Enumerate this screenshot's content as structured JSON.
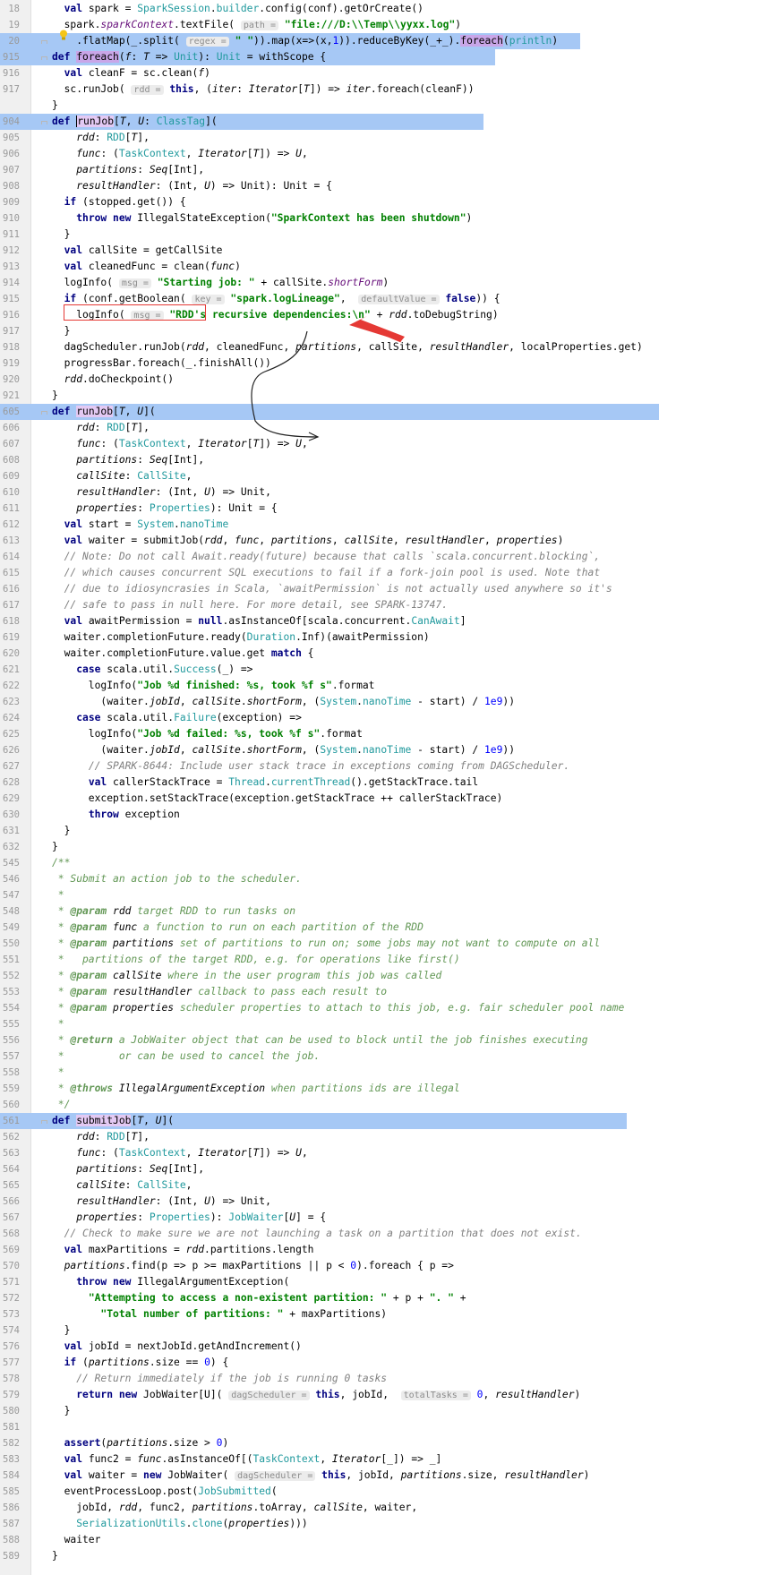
{
  "editor": {
    "highlight_color": "#a6c8f5",
    "annotation_color": "#e53935",
    "lines": [
      {
        "n": "18",
        "h": "  <span class=\"kw\">val</span> spark = <span class=\"typ\">SparkSession</span>.<span class=\"typ\">builder</span>.config(conf).getOrCreate()"
      },
      {
        "n": "19",
        "h": "  spark.<span class=\"fld\">sparkContext</span>.textFile( <span class=\"hint\">path =</span> <span class=\"str\">\"file:///D:\\\\Temp\\\\yyxx.log\"</span>)"
      },
      {
        "n": "20",
        "hl": true,
        "h": "    .flatMap(_.split( <span class=\"hint\">regex =</span> <span class=\"str\">\" \"</span>)).map(x=>(x,<span class=\"num\">1</span>)).reduceByKey(_+_).<span class=\"mark\">foreach</span>(<span class=\"typ\">println</span>)"
      },
      {
        "n": "915",
        "hl": true,
        "h": "<span class=\"kw\">def</span> <span class=\"mark\">foreach</span>(<span class=\"ital\">f</span>: <span class=\"ital\">T</span> => <span class=\"typ\">Unit</span>): <span class=\"typ\">Unit</span> = withScope {"
      },
      {
        "n": "916",
        "h": "  <span class=\"kw\">val</span> cleanF = sc.clean(<span class=\"ital\">f</span>)"
      },
      {
        "n": "917",
        "h": "  sc.runJob( <span class=\"hint\">rdd =</span> <span class=\"kw\">this</span>, (<span class=\"ital\">iter</span>: <span class=\"ital\">Iterator</span>[<span class=\"ital\">T</span>]) => <span class=\"ital\">iter</span>.foreach(cleanF))"
      },
      {
        "n": "",
        "h": "}"
      },
      {
        "n": "904",
        "hl": true,
        "h": "<span class=\"kw\">def</span> <span class=\"mark2 caret\">runJob</span>[<span class=\"ital\">T</span>, <span class=\"ital\">U</span>: <span class=\"typ\">ClassTag</span>]("
      },
      {
        "n": "905",
        "h": "    <span class=\"ital\">rdd</span>: <span class=\"typ\">RDD</span>[<span class=\"ital\">T</span>],"
      },
      {
        "n": "906",
        "h": "    <span class=\"ital\">func</span>: (<span class=\"typ\">TaskContext</span>, <span class=\"ital\">Iterator</span>[<span class=\"ital\">T</span>]) => <span class=\"ital\">U</span>,"
      },
      {
        "n": "907",
        "h": "    <span class=\"ital\">partitions</span>: <span class=\"ital\">Seq</span>[Int],"
      },
      {
        "n": "908",
        "h": "    <span class=\"ital\">resultHandler</span>: (Int, <span class=\"ital\">U</span>) => Unit): Unit = {"
      },
      {
        "n": "909",
        "h": "  <span class=\"kw\">if</span> (stopped.get()) {"
      },
      {
        "n": "910",
        "h": "    <span class=\"kw\">throw new</span> IllegalStateException(<span class=\"str\">\"SparkContext has been shutdown\"</span>)"
      },
      {
        "n": "911",
        "h": "  }"
      },
      {
        "n": "912",
        "h": "  <span class=\"kw\">val</span> callSite = getCallSite"
      },
      {
        "n": "913",
        "h": "  <span class=\"kw\">val</span> cleanedFunc = clean(<span class=\"ital\">func</span>)"
      },
      {
        "n": "914",
        "h": "  logInfo( <span class=\"hint\">msg =</span> <span class=\"str\">\"Starting job: \"</span> + callSite.<span class=\"fld\">shortForm</span>)"
      },
      {
        "n": "915",
        "h": "  <span class=\"kw\">if</span> (conf.getBoolean( <span class=\"hint\">key =</span> <span class=\"str\">\"spark.logLineage\"</span>,  <span class=\"hint\">defaultValue =</span> <span class=\"kw\">false</span>)) {"
      },
      {
        "n": "916",
        "h": "    logInfo( <span class=\"hint\">msg =</span> <span class=\"str\">\"RDD's recursive dependencies:\\n\"</span> + <span class=\"ital\">rdd</span>.toDebugString)"
      },
      {
        "n": "917",
        "h": "  }"
      },
      {
        "n": "918",
        "h": "  dagScheduler.runJob(<span class=\"ital\">rdd</span>, cleanedFunc, <span class=\"ital\">partitions</span>, callSite, <span class=\"ital\">resultHandler</span>, localProperties.get)"
      },
      {
        "n": "919",
        "h": "  progressBar.foreach(_.finishAll())"
      },
      {
        "n": "920",
        "h": "  <span class=\"ital\">rdd</span>.doCheckpoint()"
      },
      {
        "n": "921",
        "h": "}"
      },
      {
        "n": "605",
        "hl": true,
        "h": "<span class=\"kw\">def</span> <span class=\"mark2\">runJob</span>[<span class=\"ital\">T</span>, <span class=\"ital\">U</span>]("
      },
      {
        "n": "606",
        "h": "    <span class=\"ital\">rdd</span>: <span class=\"typ\">RDD</span>[<span class=\"ital\">T</span>],"
      },
      {
        "n": "607",
        "h": "    <span class=\"ital\">func</span>: (<span class=\"typ\">TaskContext</span>, <span class=\"ital\">Iterator</span>[<span class=\"ital\">T</span>]) => <span class=\"ital\">U</span>,"
      },
      {
        "n": "608",
        "h": "    <span class=\"ital\">partitions</span>: <span class=\"ital\">Seq</span>[Int],"
      },
      {
        "n": "609",
        "h": "    <span class=\"ital\">callSite</span>: <span class=\"typ\">CallSite</span>,"
      },
      {
        "n": "610",
        "h": "    <span class=\"ital\">resultHandler</span>: (Int, <span class=\"ital\">U</span>) => Unit,"
      },
      {
        "n": "611",
        "h": "    <span class=\"ital\">properties</span>: <span class=\"typ\">Properties</span>): Unit = {"
      },
      {
        "n": "612",
        "h": "  <span class=\"kw\">val</span> start = <span class=\"typ\">System</span>.<span class=\"typ\">nanoTime</span>"
      },
      {
        "n": "613",
        "h": "  <span class=\"kw\">val</span> waiter = submitJob(<span class=\"ital\">rdd</span>, <span class=\"ital\">func</span>, <span class=\"ital\">partitions</span>, <span class=\"ital\">callSite</span>, <span class=\"ital\">resultHandler</span>, <span class=\"ital\">properties</span>)"
      },
      {
        "n": "614",
        "h": "  <span class=\"cmt\">// Note: Do not call Await.ready(future) because that calls `scala.concurrent.blocking`,</span>"
      },
      {
        "n": "615",
        "h": "  <span class=\"cmt\">// which causes concurrent SQL executions to fail if a fork-join pool is used. Note that</span>"
      },
      {
        "n": "616",
        "h": "  <span class=\"cmt\">// due to idiosyncrasies in Scala, `awaitPermission` is not actually used anywhere so it's</span>"
      },
      {
        "n": "617",
        "h": "  <span class=\"cmt\">// safe to pass in null here. For more detail, see SPARK-13747.</span>"
      },
      {
        "n": "618",
        "h": "  <span class=\"kw\">val</span> awaitPermission = <span class=\"kw\">null</span>.asInstanceOf[scala.concurrent.<span class=\"typ\">CanAwait</span>]"
      },
      {
        "n": "619",
        "h": "  waiter.completionFuture.ready(<span class=\"typ\">Duration</span>.Inf)(awaitPermission)"
      },
      {
        "n": "620",
        "h": "  waiter.completionFuture.value.get <span class=\"kw\">match</span> {"
      },
      {
        "n": "621",
        "h": "    <span class=\"kw\">case</span> scala.util.<span class=\"typ\">Success</span>(_) =>"
      },
      {
        "n": "622",
        "h": "      logInfo(<span class=\"str\">\"Job %d finished: %s, took %f s\"</span>.format"
      },
      {
        "n": "623",
        "h": "        (waiter.<span class=\"ital\">jobId</span>, <span class=\"ital\">callSite</span>.<span class=\"ital\">shortForm</span>, (<span class=\"typ\">System</span>.<span class=\"typ\">nanoTime</span> - start) / <span class=\"num\">1e9</span>))"
      },
      {
        "n": "624",
        "h": "    <span class=\"kw\">case</span> scala.util.<span class=\"typ\">Failure</span>(exception) =>"
      },
      {
        "n": "625",
        "h": "      logInfo(<span class=\"str\">\"Job %d failed: %s, took %f s\"</span>.format"
      },
      {
        "n": "626",
        "h": "        (waiter.<span class=\"ital\">jobId</span>, <span class=\"ital\">callSite</span>.<span class=\"ital\">shortForm</span>, (<span class=\"typ\">System</span>.<span class=\"typ\">nanoTime</span> - start) / <span class=\"num\">1e9</span>))"
      },
      {
        "n": "627",
        "h": "      <span class=\"cmt\">// SPARK-8644: Include user stack trace in exceptions coming from DAGScheduler.</span>"
      },
      {
        "n": "628",
        "h": "      <span class=\"kw\">val</span> callerStackTrace = <span class=\"typ\">Thread</span>.<span class=\"typ\">currentThread</span>().getStackTrace.tail"
      },
      {
        "n": "629",
        "h": "      exception.setStackTrace(exception.getStackTrace ++ callerStackTrace)"
      },
      {
        "n": "630",
        "h": "      <span class=\"kw\">throw</span> exception"
      },
      {
        "n": "631",
        "h": "  }"
      },
      {
        "n": "632",
        "h": "}"
      },
      {
        "n": "545",
        "h": "<span class=\"doc\">/**</span>"
      },
      {
        "n": "546",
        "h": "<span class=\"doc\"> * Submit an action job to the scheduler.</span>"
      },
      {
        "n": "547",
        "h": "<span class=\"doc\"> *</span>"
      },
      {
        "n": "548",
        "h": "<span class=\"doc\"> * <span class=\"doctag\">@param</span> <span class=\"ital\">rdd</span> target RDD to run tasks on</span>"
      },
      {
        "n": "549",
        "h": "<span class=\"doc\"> * <span class=\"doctag\">@param</span> <span class=\"ital\">func</span> a function to run on each partition of the RDD</span>"
      },
      {
        "n": "550",
        "h": "<span class=\"doc\"> * <span class=\"doctag\">@param</span> <span class=\"ital\">partitions</span> set of partitions to run on; some jobs may not want to compute on all</span>"
      },
      {
        "n": "551",
        "h": "<span class=\"doc\"> *   partitions of the target RDD, e.g. for operations like first()</span>"
      },
      {
        "n": "552",
        "h": "<span class=\"doc\"> * <span class=\"doctag\">@param</span> <span class=\"ital\">callSite</span> where in the user program this job was called</span>"
      },
      {
        "n": "553",
        "h": "<span class=\"doc\"> * <span class=\"doctag\">@param</span> <span class=\"ital\">resultHandler</span> callback to pass each result to</span>"
      },
      {
        "n": "554",
        "h": "<span class=\"doc\"> * <span class=\"doctag\">@param</span> <span class=\"ital\">properties</span> scheduler properties to attach to this job, e.g. fair scheduler pool name</span>"
      },
      {
        "n": "555",
        "h": "<span class=\"doc\"> *</span>"
      },
      {
        "n": "556",
        "h": "<span class=\"doc\"> * <span class=\"doctag\">@return</span> a JobWaiter object that can be used to block until the job finishes executing</span>"
      },
      {
        "n": "557",
        "h": "<span class=\"doc\"> *         or can be used to cancel the job.</span>"
      },
      {
        "n": "558",
        "h": "<span class=\"doc\"> *</span>"
      },
      {
        "n": "559",
        "h": "<span class=\"doc\"> * <span class=\"doctag\">@throws</span> <span class=\"ital\">IllegalArgumentException</span> when partitions ids are illegal</span>"
      },
      {
        "n": "560",
        "h": "<span class=\"doc\"> */</span>"
      },
      {
        "n": "561",
        "hl": true,
        "h": "<span class=\"kw\">def</span> <span class=\"mark2\">submitJob</span>[<span class=\"ital\">T</span>, <span class=\"ital\">U</span>]("
      },
      {
        "n": "562",
        "h": "    <span class=\"ital\">rdd</span>: <span class=\"typ\">RDD</span>[<span class=\"ital\">T</span>],"
      },
      {
        "n": "563",
        "h": "    <span class=\"ital\">func</span>: (<span class=\"typ\">TaskContext</span>, <span class=\"ital\">Iterator</span>[<span class=\"ital\">T</span>]) => <span class=\"ital\">U</span>,"
      },
      {
        "n": "564",
        "h": "    <span class=\"ital\">partitions</span>: <span class=\"ital\">Seq</span>[Int],"
      },
      {
        "n": "565",
        "h": "    <span class=\"ital\">callSite</span>: <span class=\"typ\">CallSite</span>,"
      },
      {
        "n": "566",
        "h": "    <span class=\"ital\">resultHandler</span>: (Int, <span class=\"ital\">U</span>) => Unit,"
      },
      {
        "n": "567",
        "h": "    <span class=\"ital\">properties</span>: <span class=\"typ\">Properties</span>): <span class=\"typ\">JobWaiter</span>[<span class=\"ital\">U</span>] = {"
      },
      {
        "n": "568",
        "h": "  <span class=\"cmt\">// Check to make sure we are not launching a task on a partition that does not exist.</span>"
      },
      {
        "n": "569",
        "h": "  <span class=\"kw\">val</span> maxPartitions = <span class=\"ital\">rdd</span>.partitions.length"
      },
      {
        "n": "570",
        "h": "  <span class=\"ital\">partitions</span>.find(p => p >= maxPartitions || p < <span class=\"num\">0</span>).foreach { p =>"
      },
      {
        "n": "571",
        "h": "    <span class=\"kw\">throw new</span> IllegalArgumentException("
      },
      {
        "n": "572",
        "h": "      <span class=\"str\">\"Attempting to access a non-existent partition: \"</span> + p + <span class=\"str\">\". \"</span> +"
      },
      {
        "n": "573",
        "h": "        <span class=\"str\">\"Total number of partitions: \"</span> + maxPartitions)"
      },
      {
        "n": "574",
        "h": "  }"
      },
      {
        "n": "576",
        "h": "  <span class=\"kw\">val</span> jobId = nextJobId.getAndIncrement()"
      },
      {
        "n": "577",
        "h": "  <span class=\"kw\">if</span> (<span class=\"ital\">partitions</span>.size == <span class=\"num\">0</span>) {"
      },
      {
        "n": "578",
        "h": "    <span class=\"cmt\">// Return immediately if the job is running 0 tasks</span>"
      },
      {
        "n": "579",
        "h": "    <span class=\"kw\">return new</span> JobWaiter[U]( <span class=\"hint\">dagScheduler =</span> <span class=\"kw\">this</span>, jobId,  <span class=\"hint\">totalTasks =</span> <span class=\"num\">0</span>, <span class=\"ital\">resultHandler</span>)"
      },
      {
        "n": "580",
        "h": "  }"
      },
      {
        "n": "581",
        "h": ""
      },
      {
        "n": "582",
        "h": "  <span class=\"kw\">assert</span>(<span class=\"ital\">partitions</span>.size > <span class=\"num\">0</span>)"
      },
      {
        "n": "583",
        "h": "  <span class=\"kw\">val</span> func2 = <span class=\"ital\">func</span>.asInstanceOf[(<span class=\"typ\">TaskContext</span>, <span class=\"ital\">Iterator</span>[_]) => _]"
      },
      {
        "n": "584",
        "h": "  <span class=\"kw\">val</span> waiter = <span class=\"kw\">new</span> JobWaiter( <span class=\"hint\">dagScheduler =</span> <span class=\"kw\">this</span>, jobId, <span class=\"ital\">partitions</span>.size, <span class=\"ital\">resultHandler</span>)"
      },
      {
        "n": "585",
        "h": "  eventProcessLoop.post(<span class=\"typ\">JobSubmitted</span>("
      },
      {
        "n": "586",
        "h": "    jobId, <span class=\"ital\">rdd</span>, func2, <span class=\"ital\">partitions</span>.toArray, <span class=\"ital\">callSite</span>, waiter,"
      },
      {
        "n": "587",
        "h": "    <span class=\"typ\">SerializationUtils</span>.<span class=\"typ\">clone</span>(<span class=\"ital\">properties</span>)))"
      },
      {
        "n": "588",
        "h": "  waiter"
      },
      {
        "n": "589",
        "h": "}"
      }
    ]
  }
}
